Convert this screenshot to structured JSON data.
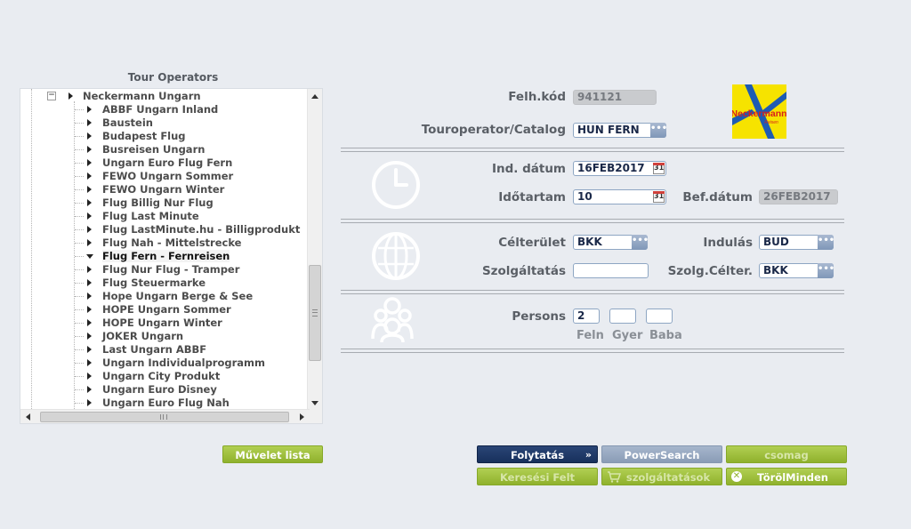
{
  "tree": {
    "title": "Tour Operators",
    "root_label": "Neckermann Ungarn",
    "items": [
      {
        "label": "ABBF Ungarn Inland"
      },
      {
        "label": "Baustein"
      },
      {
        "label": "Budapest Flug"
      },
      {
        "label": "Busreisen Ungarn"
      },
      {
        "label": "Ungarn Euro Flug Fern"
      },
      {
        "label": "FEWO Ungarn Sommer"
      },
      {
        "label": "FEWO Ungarn Winter"
      },
      {
        "label": "Flug Billig Nur Flug"
      },
      {
        "label": "Flug Last Minute"
      },
      {
        "label": "Flug LastMinute.hu - Billigprodukt"
      },
      {
        "label": "Flug Nah - Mittelstrecke"
      },
      {
        "label": "Flug Fern - Fernreisen",
        "expanded": true,
        "selected": true
      },
      {
        "label": "Flug Nur Flug - Tramper"
      },
      {
        "label": "Flug Steuermarke"
      },
      {
        "label": "Hope Ungarn Berge & See"
      },
      {
        "label": "HOPE Ungarn Sommer"
      },
      {
        "label": "HOPE Ungarn Winter"
      },
      {
        "label": "JOKER Ungarn"
      },
      {
        "label": "Last Ungarn ABBF"
      },
      {
        "label": "Ungarn Individualprogramm"
      },
      {
        "label": "Ungarn City Produkt"
      },
      {
        "label": "Ungarn Euro Disney"
      },
      {
        "label": "Ungarn Euro Flug Nah"
      }
    ]
  },
  "form": {
    "user_code_label": "Felh.kód",
    "user_code_value": "941121",
    "touroperator_label": "Touroperator/Catalog",
    "touroperator_value": "HUN FERN",
    "start_date_label": "Ind. dátum",
    "start_date_value": "16FEB2017",
    "duration_label": "Időtartam",
    "duration_value": "10",
    "end_date_label": "Bef.dátum",
    "end_date_value": "26FEB2017",
    "destination_label": "Célterület",
    "destination_value": "BKK",
    "departure_label": "Indulás",
    "departure_value": "BUD",
    "service_label": "Szolgáltatás",
    "service_value": "",
    "service_dest_label": "Szolg.Célter.",
    "service_dest_value": "BKK",
    "persons_label": "Persons",
    "adults_value": "2",
    "children_value": "",
    "infants_value": "",
    "adults_label": "Feln",
    "children_label": "Gyer",
    "infants_label": "Baba",
    "calendar_day": "31"
  },
  "logo": {
    "name": "neckermann-logo",
    "text": "Neckermann",
    "subtext": "Reisen"
  },
  "buttons": {
    "action_list": "Művelet lista",
    "continue": "Folytatás",
    "powersearch": "PowerSearch",
    "package": "csomag",
    "search_conditions": "Keresési Felt",
    "services": "szolgáltatások",
    "delete_all": "TörölMinden"
  },
  "colors": {
    "background": "#e9ecf1",
    "green": "#9cbd3a",
    "navy": "#1f3a6b",
    "grayblue": "#97a8c1",
    "logo_yellow": "#f6e300",
    "logo_blue": "#1e5bb3",
    "logo_red": "#d8211b"
  },
  "icons": [
    "clock-icon",
    "globe-icon",
    "people-icon",
    "calendar-icon",
    "ellipsis-icon",
    "cart-icon",
    "close-circle-icon",
    "double-chevron-icon"
  ]
}
